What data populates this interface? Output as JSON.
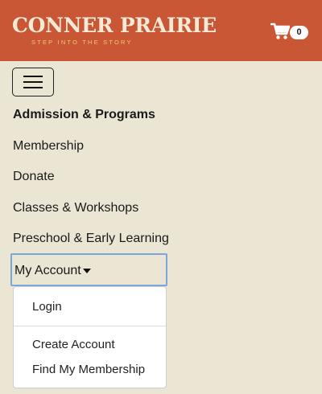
{
  "header": {
    "logo_title": "CONNER PRAIRIE",
    "logo_tagline": "STEP INTO THE STORY",
    "cart_count": "0",
    "cart_icon": "shopping-cart-icon",
    "background_color": "#c95735"
  },
  "menu_toggle": {
    "icon": "hamburger-icon"
  },
  "nav": {
    "items": [
      {
        "label": "Admission & Programs"
      },
      {
        "label": "Membership"
      },
      {
        "label": "Donate"
      },
      {
        "label": "Classes & Workshops"
      },
      {
        "label": "Preschool & Early Learning"
      }
    ],
    "account": {
      "label": "My Account",
      "dropdown": [
        {
          "label": "Login"
        },
        {
          "label": "Create Account"
        },
        {
          "label": "Find My Membership"
        }
      ]
    }
  }
}
